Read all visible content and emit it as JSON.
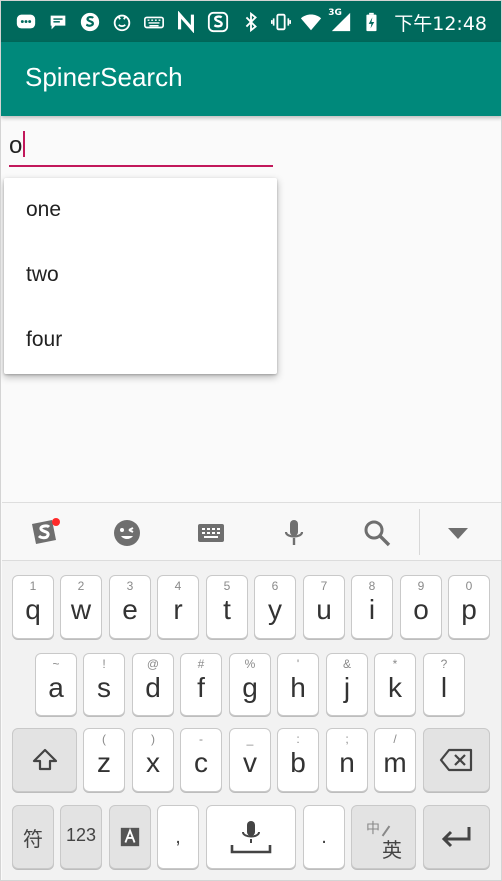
{
  "status_bar": {
    "time": "下午12:48",
    "network": "3G",
    "left_icons": [
      "chat-icon",
      "message-icon",
      "sogou-s-icon",
      "face-icon",
      "keyboard-icon",
      "n-icon",
      "sogou-input-icon"
    ],
    "right_icons": [
      "bluetooth-icon",
      "vibrate-icon",
      "wifi-icon",
      "signal-icon",
      "battery-charging-icon"
    ]
  },
  "app_bar": {
    "title": "SpinerSearch",
    "color": "#00897b"
  },
  "search": {
    "value": "o"
  },
  "dropdown": {
    "items": [
      "one",
      "two",
      "four"
    ]
  },
  "keyboard": {
    "toolbar": [
      "sogou-logo-icon",
      "emoji-icon",
      "keyboard-layout-icon",
      "microphone-icon",
      "search-icon",
      "collapse-icon"
    ],
    "row1": [
      {
        "hint": "1",
        "key": "q"
      },
      {
        "hint": "2",
        "key": "w"
      },
      {
        "hint": "3",
        "key": "e"
      },
      {
        "hint": "4",
        "key": "r"
      },
      {
        "hint": "5",
        "key": "t"
      },
      {
        "hint": "6",
        "key": "y"
      },
      {
        "hint": "7",
        "key": "u"
      },
      {
        "hint": "8",
        "key": "i"
      },
      {
        "hint": "9",
        "key": "o"
      },
      {
        "hint": "0",
        "key": "p"
      }
    ],
    "row2": [
      {
        "hint": "~",
        "key": "a"
      },
      {
        "hint": "!",
        "key": "s"
      },
      {
        "hint": "@",
        "key": "d"
      },
      {
        "hint": "#",
        "key": "f"
      },
      {
        "hint": "%",
        "key": "g"
      },
      {
        "hint": "'",
        "key": "h"
      },
      {
        "hint": "&",
        "key": "j"
      },
      {
        "hint": "*",
        "key": "k"
      },
      {
        "hint": "?",
        "key": "l"
      }
    ],
    "row3": [
      {
        "hint": "(",
        "key": "z"
      },
      {
        "hint": ")",
        "key": "x"
      },
      {
        "hint": "-",
        "key": "c"
      },
      {
        "hint": "_",
        "key": "v"
      },
      {
        "hint": ":",
        "key": "b"
      },
      {
        "hint": ";",
        "key": "n"
      },
      {
        "hint": "/",
        "key": "m"
      }
    ],
    "row4": {
      "symbols": "符",
      "numbers": "123",
      "comma": ",",
      "period": ".",
      "lang_top": "中",
      "lang_bottom": "英"
    }
  }
}
